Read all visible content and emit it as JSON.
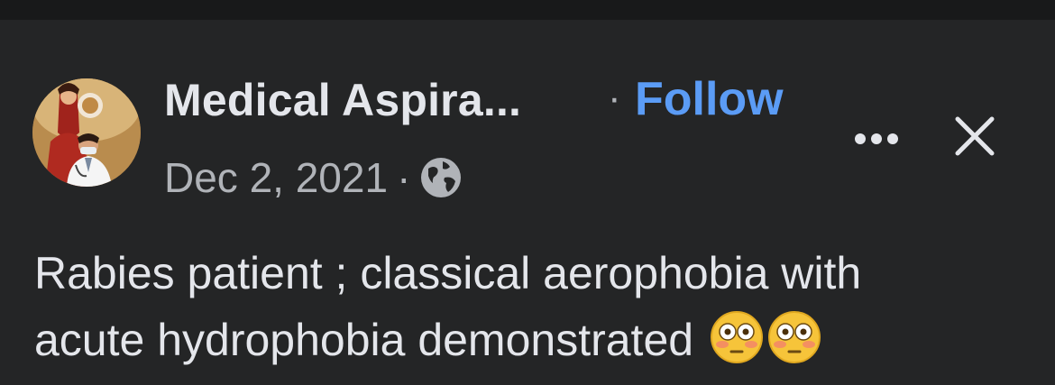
{
  "post": {
    "author_name": "Medical Aspira...",
    "dot_separator": "·",
    "follow_label": "Follow",
    "date": "Dec 2, 2021",
    "meta_separator": "·",
    "privacy_icon": "globe-icon",
    "more_icon": "more-options-icon",
    "close_icon": "close-icon",
    "text_line1": "Rabies patient ; classical aerophobia with",
    "text_line2": "acute hydrophobia demonstrated",
    "emoji": [
      "flushed-face-icon",
      "flushed-face-icon"
    ]
  },
  "colors": {
    "background": "#242526",
    "top_strip": "#18191a",
    "primary_text": "#e4e6eb",
    "secondary_text": "#b0b3b8",
    "follow_blue": "#5b9cf6"
  }
}
